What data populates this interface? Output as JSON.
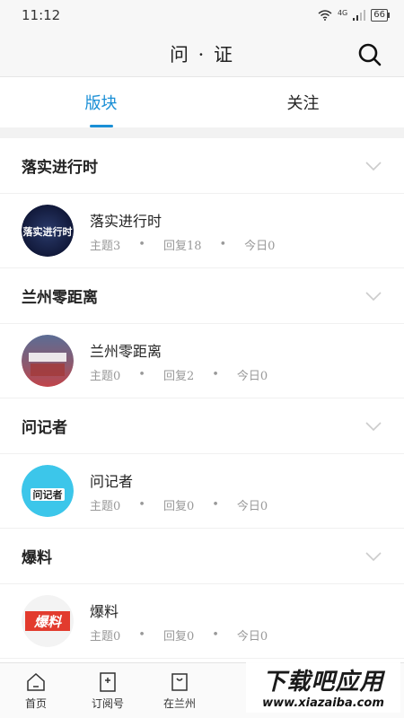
{
  "status_bar": {
    "time": "11:12",
    "network": "4G",
    "battery": "66"
  },
  "header": {
    "title": "问 · 证",
    "search_icon": "search-icon"
  },
  "tabs": [
    {
      "label": "版块",
      "active": true
    },
    {
      "label": "关注",
      "active": false
    }
  ],
  "sections": [
    {
      "title": "落实进行时",
      "forum": {
        "name": "落实进行时",
        "topics": "主题3",
        "replies": "回复18",
        "today": "今日0",
        "avatar_text": "落实进行时"
      }
    },
    {
      "title": "兰州零距离",
      "forum": {
        "name": "兰州零距离",
        "topics": "主题0",
        "replies": "回复2",
        "today": "今日0",
        "avatar_text": ""
      }
    },
    {
      "title": "问记者",
      "forum": {
        "name": "问记者",
        "topics": "主题0",
        "replies": "回复0",
        "today": "今日0",
        "avatar_text": "问记者"
      }
    },
    {
      "title": "爆料",
      "forum": {
        "name": "爆料",
        "topics": "主题0",
        "replies": "回复0",
        "today": "今日0",
        "avatar_text": "爆料"
      }
    }
  ],
  "separator": "•",
  "bottom_nav": [
    {
      "label": "首页",
      "icon": "home-icon"
    },
    {
      "label": "订阅号",
      "icon": "subscribe-icon"
    },
    {
      "label": "在兰州",
      "icon": "bag-icon"
    }
  ],
  "watermark": {
    "main": "下载吧应用",
    "url": "www.xiazaiba.com"
  },
  "colors": {
    "accent": "#1a8fd6",
    "muted": "#999999"
  }
}
